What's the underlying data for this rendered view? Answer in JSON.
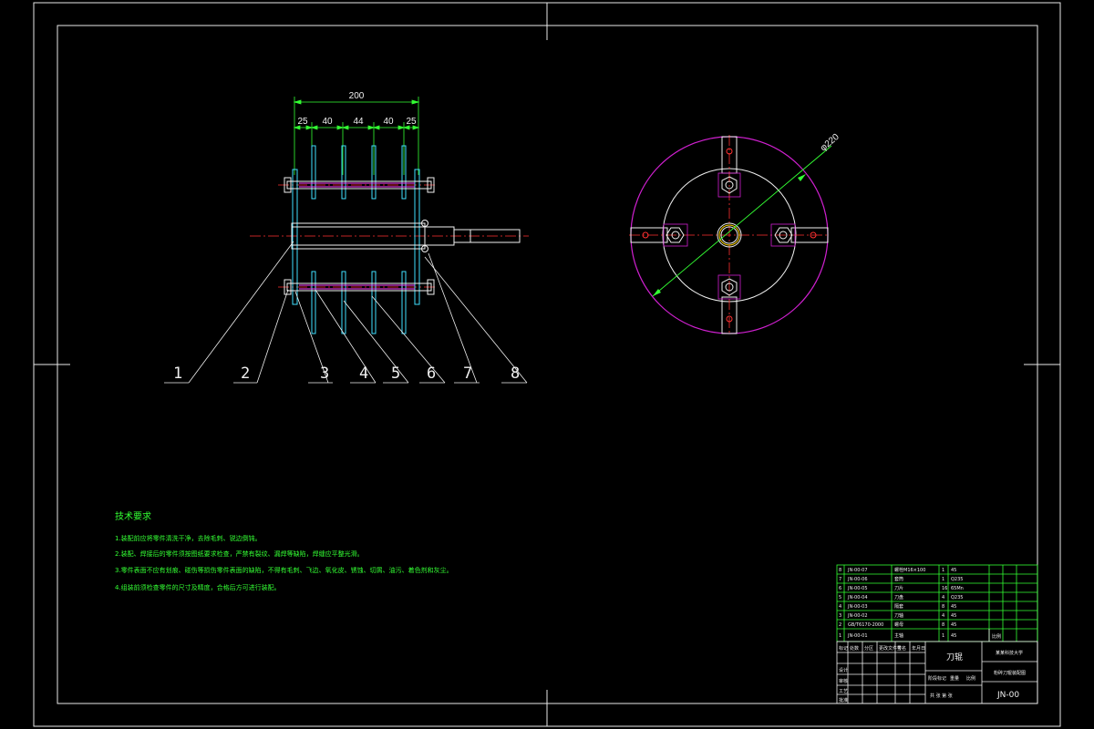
{
  "dimensions": {
    "overall": "200",
    "segments": [
      "25",
      "40",
      "44",
      "40",
      "25"
    ],
    "diameter": "φ220"
  },
  "callouts": [
    "1",
    "2",
    "3",
    "4",
    "5",
    "6",
    "7",
    "8"
  ],
  "technical_requirements": {
    "title": "技术要求",
    "items": [
      "1.装配前应将零件清洗干净，去除毛刺、锐边倒钝。",
      "2.装配、焊接后的零件须按图纸要求检查，严禁有裂纹、漏焊等缺陷，焊缝应平整光滑。",
      "3.零件表面不应有划痕、碰伤等损伤零件表面的缺陷，不得有毛刺、飞边、氧化皮、锈蚀、切屑、油污、着色剂和灰尘。",
      "4.组装前须检查零件的尺寸及精度，合格后方可进行装配。"
    ]
  },
  "parts_list": [
    {
      "no": "8",
      "code": "JN-00-07",
      "name": "螺栓M16×100",
      "qty": "1",
      "material": "45"
    },
    {
      "no": "7",
      "code": "JN-00-06",
      "name": "套筒",
      "qty": "1",
      "material": "Q235"
    },
    {
      "no": "6",
      "code": "JN-00-05",
      "name": "刀片",
      "qty": "16",
      "material": "65Mn"
    },
    {
      "no": "5",
      "code": "JN-00-04",
      "name": "刀盘",
      "qty": "4",
      "material": "Q235"
    },
    {
      "no": "4",
      "code": "JN-00-03",
      "name": "隔套",
      "qty": "8",
      "material": "45"
    },
    {
      "no": "3",
      "code": "JN-00-02",
      "name": "刀轴",
      "qty": "4",
      "material": "45"
    },
    {
      "no": "2",
      "code": "GB/T6170-2000",
      "name": "螺母",
      "qty": "8",
      "material": "45"
    },
    {
      "no": "1",
      "code": "JN-00-01",
      "name": "主轴",
      "qty": "1",
      "material": "45"
    }
  ],
  "title_block": {
    "university": "某某科技大学",
    "drawing_name": "刀辊",
    "assembly_name": "粉碎刀辊装配图",
    "drawing_number": "JN-00",
    "scale_label": "比例",
    "sheet_label": "共 张 第 张",
    "header_labels": [
      "标记",
      "处数",
      "分区",
      "更改文件号",
      "签名",
      "年月日"
    ],
    "role_labels": [
      "设计",
      "审核",
      "工艺",
      "批准"
    ],
    "stage_labels": [
      "阶段标记",
      "重量",
      "比例"
    ]
  }
}
